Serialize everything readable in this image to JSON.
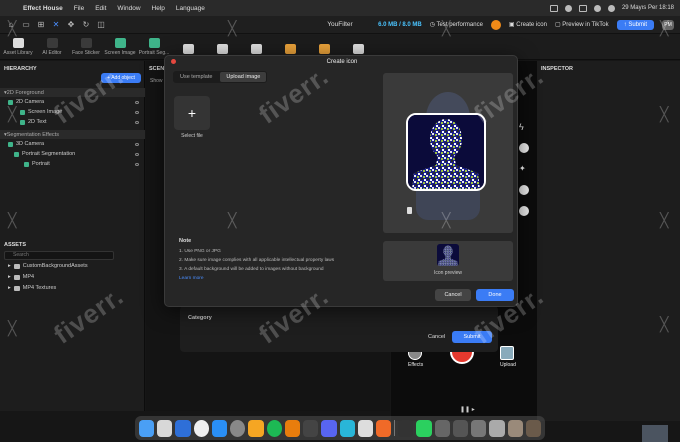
{
  "menubar": {
    "app_name": "Effect House",
    "items": [
      "File",
      "Edit",
      "Window",
      "Help",
      "Language"
    ],
    "datetime": "29 Mayıs Per  18:18"
  },
  "titlebar": {
    "project_title": "YouFilter",
    "memory": "6.0 MB / 8.0 MB",
    "test_performance": "Test performance",
    "create_icon": "Create icon",
    "preview_tiktok": "Preview in TikTok",
    "submit": "Submit",
    "avatar": "PM"
  },
  "toolbar": {
    "items": [
      "Asset Library",
      "AI Editor",
      "Face Sticker",
      "Screen Image",
      "Portrait Seg...",
      "",
      "",
      "",
      "",
      "",
      ""
    ]
  },
  "hierarchy": {
    "title": "HIERARCHY",
    "add_object": "Add object",
    "groups": [
      {
        "name": "2D Foreground",
        "items": [
          {
            "label": "2D Camera",
            "level": 1,
            "color": "#3fb48a"
          },
          {
            "label": "Screen Image",
            "level": 2,
            "color": "#3fb48a"
          },
          {
            "label": "2D Text",
            "level": 2,
            "color": "#3fb48a"
          }
        ]
      },
      {
        "name": "Segmentation Effects",
        "items": [
          {
            "label": "3D Camera",
            "level": 1,
            "color": "#3fb48a"
          },
          {
            "label": "Portrait Segmentation",
            "level": 2,
            "color": "#3fb48a"
          },
          {
            "label": "Portrait",
            "level": 3,
            "color": "#3fb48a"
          }
        ]
      }
    ]
  },
  "assets": {
    "title": "ASSETS",
    "search_placeholder": "Search",
    "folders": [
      "CustomBackgroundAssets",
      "MP4",
      "MP4 Textures"
    ]
  },
  "scene": {
    "title": "SCENE",
    "show_label": "Show"
  },
  "inspector": {
    "title": "INSPECTOR"
  },
  "preview": {
    "effects": "Effects",
    "upload": "Upload"
  },
  "submit_sheet": {
    "category": "Category",
    "cancel": "Cancel",
    "submit": "Submit"
  },
  "modal": {
    "title": "Create icon",
    "tabs": [
      {
        "label": "Use template",
        "active": false
      },
      {
        "label": "Upload image",
        "active": true
      }
    ],
    "select_file": "Select file",
    "note_title": "Note",
    "notes": [
      "1. Use PNG or JPG",
      "2. Make sure image complies with all applicable intellectual property laws",
      "3. A default background will be added to images without background"
    ],
    "learn_more": "Learn more",
    "icon_preview": "Icon preview",
    "cancel": "Cancel",
    "done": "Done"
  },
  "watermark": "fiverr.",
  "colors": {
    "accent": "#3b7cf5",
    "bell": "#f08a18",
    "record": "#e5392e",
    "camera_icon": "#3fb48a"
  }
}
